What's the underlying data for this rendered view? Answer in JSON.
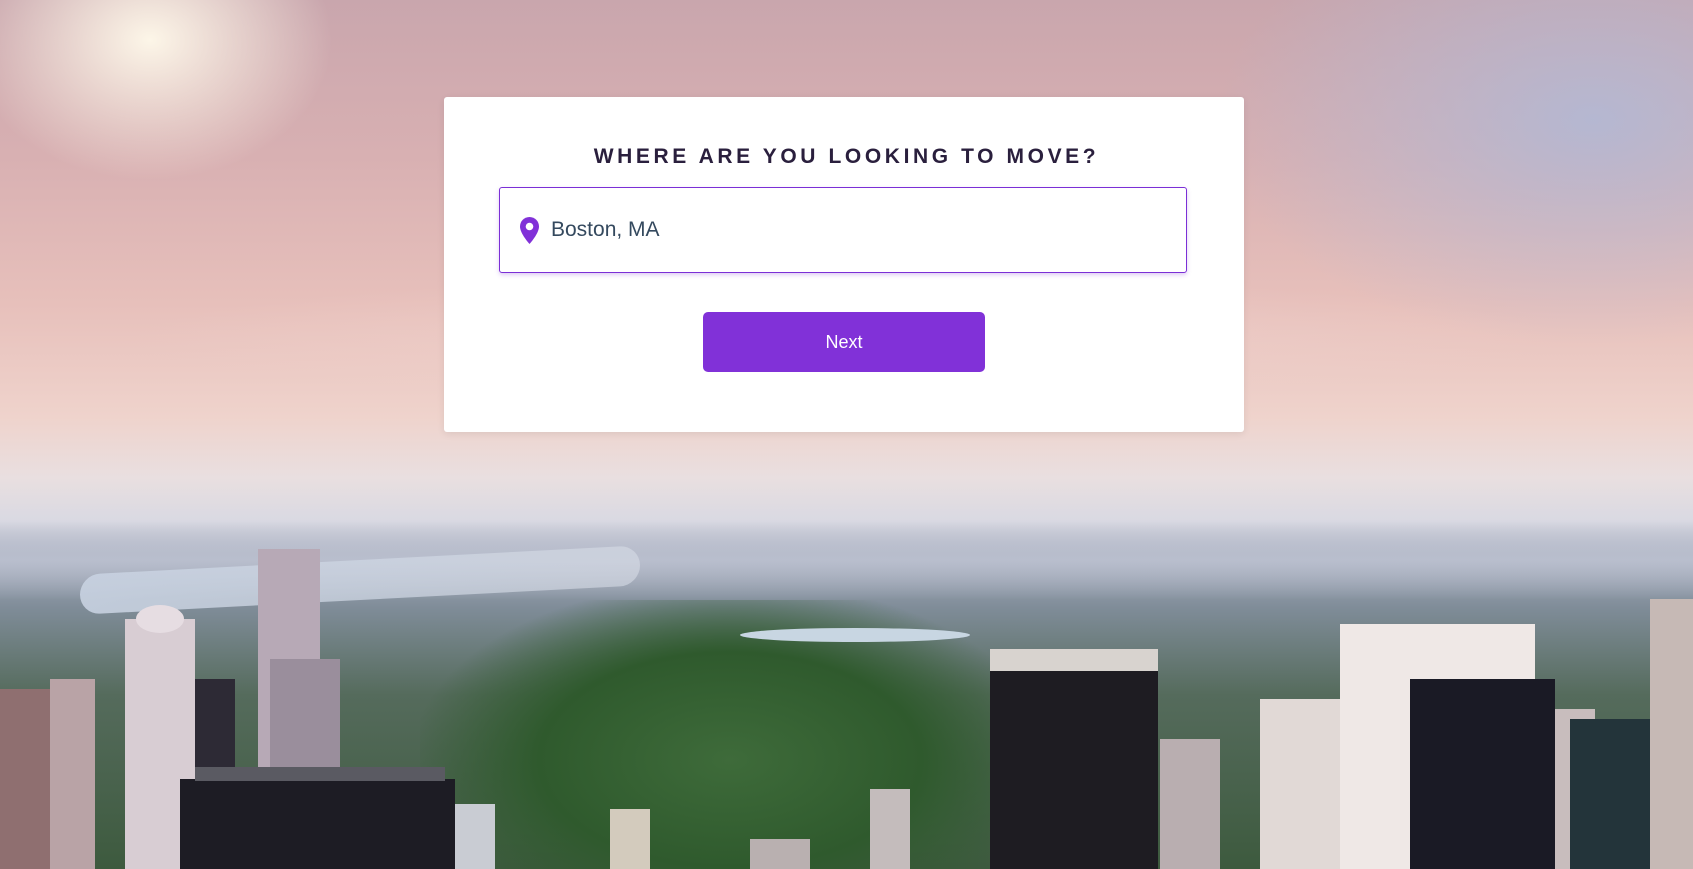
{
  "form": {
    "heading": "WHERE ARE YOU LOOKING TO MOVE?",
    "location_value": "Boston, MA",
    "next_label": "Next"
  },
  "icons": {
    "location": "map-pin-icon"
  },
  "colors": {
    "accent": "#8131d8",
    "input_text": "#34495e",
    "heading_text": "#2a1f3d",
    "card_background": "#ffffff"
  }
}
